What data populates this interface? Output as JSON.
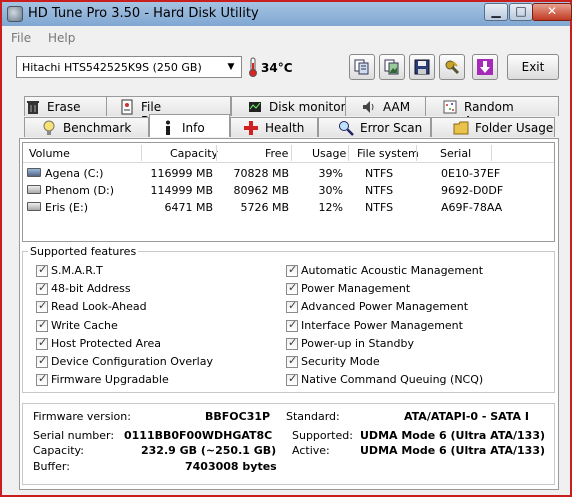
{
  "window": {
    "title": "HD Tune Pro 3.50 - Hard Disk Utility",
    "min": "▁",
    "max": "□",
    "close": "✕"
  },
  "menu": {
    "file": "File",
    "help": "Help"
  },
  "toolbar": {
    "drive": "Hitachi HTS542525K9S (250 GB)",
    "temperature": "34°C",
    "exit": "Exit"
  },
  "tabs_top": [
    "Erase",
    "File Benchmark",
    "Disk monitor",
    "AAM",
    "Random Access"
  ],
  "tabs_bottom": [
    "Benchmark",
    "Info",
    "Health",
    "Error Scan",
    "Folder Usage"
  ],
  "active_tab": "Info",
  "volumes": {
    "headers": [
      "Volume",
      "Capacity",
      "Free",
      "Usage",
      "File system",
      "Serial"
    ],
    "rows": [
      [
        "Agena (C:)",
        "116999 MB",
        "70828 MB",
        "39%",
        "NTFS",
        "0E10-37EF"
      ],
      [
        "Phenom (D:)",
        "114999 MB",
        "80962 MB",
        "30%",
        "NTFS",
        "9692-D0DF"
      ],
      [
        "Eris (E:)",
        "6471 MB",
        "5726 MB",
        "12%",
        "NTFS",
        "A69F-78AA"
      ]
    ]
  },
  "features": {
    "label": "Supported features",
    "left": [
      "S.M.A.R.T",
      "48-bit Address",
      "Read Look-Ahead",
      "Write Cache",
      "Host Protected Area",
      "Device Configuration Overlay",
      "Firmware Upgradable"
    ],
    "right": [
      "Automatic Acoustic Management",
      "Power Management",
      "Advanced Power Management",
      "Interface Power Management",
      "Power-up in Standby",
      "Security Mode",
      "Native Command Queuing (NCQ)"
    ]
  },
  "info": {
    "firmware_label": "Firmware version:",
    "firmware": "BBFOC31P",
    "serial_label": "Serial number:",
    "serial": "0111BB0F00WDHGAT8C",
    "capacity_label": "Capacity:",
    "capacity": "232.9 GB (~250.1 GB)",
    "buffer_label": "Buffer:",
    "buffer": "7403008 bytes",
    "standard_label": "Standard:",
    "standard": "ATA/ATAPI-0 - SATA I",
    "supported_label": "Supported:",
    "supported": "UDMA Mode 6 (Ultra ATA/133)",
    "active_label": "Active:",
    "active": "UDMA Mode 6 (Ultra ATA/133)"
  },
  "colors": {
    "border": "#c81e1e",
    "titlebar": "#8fb2d8"
  }
}
